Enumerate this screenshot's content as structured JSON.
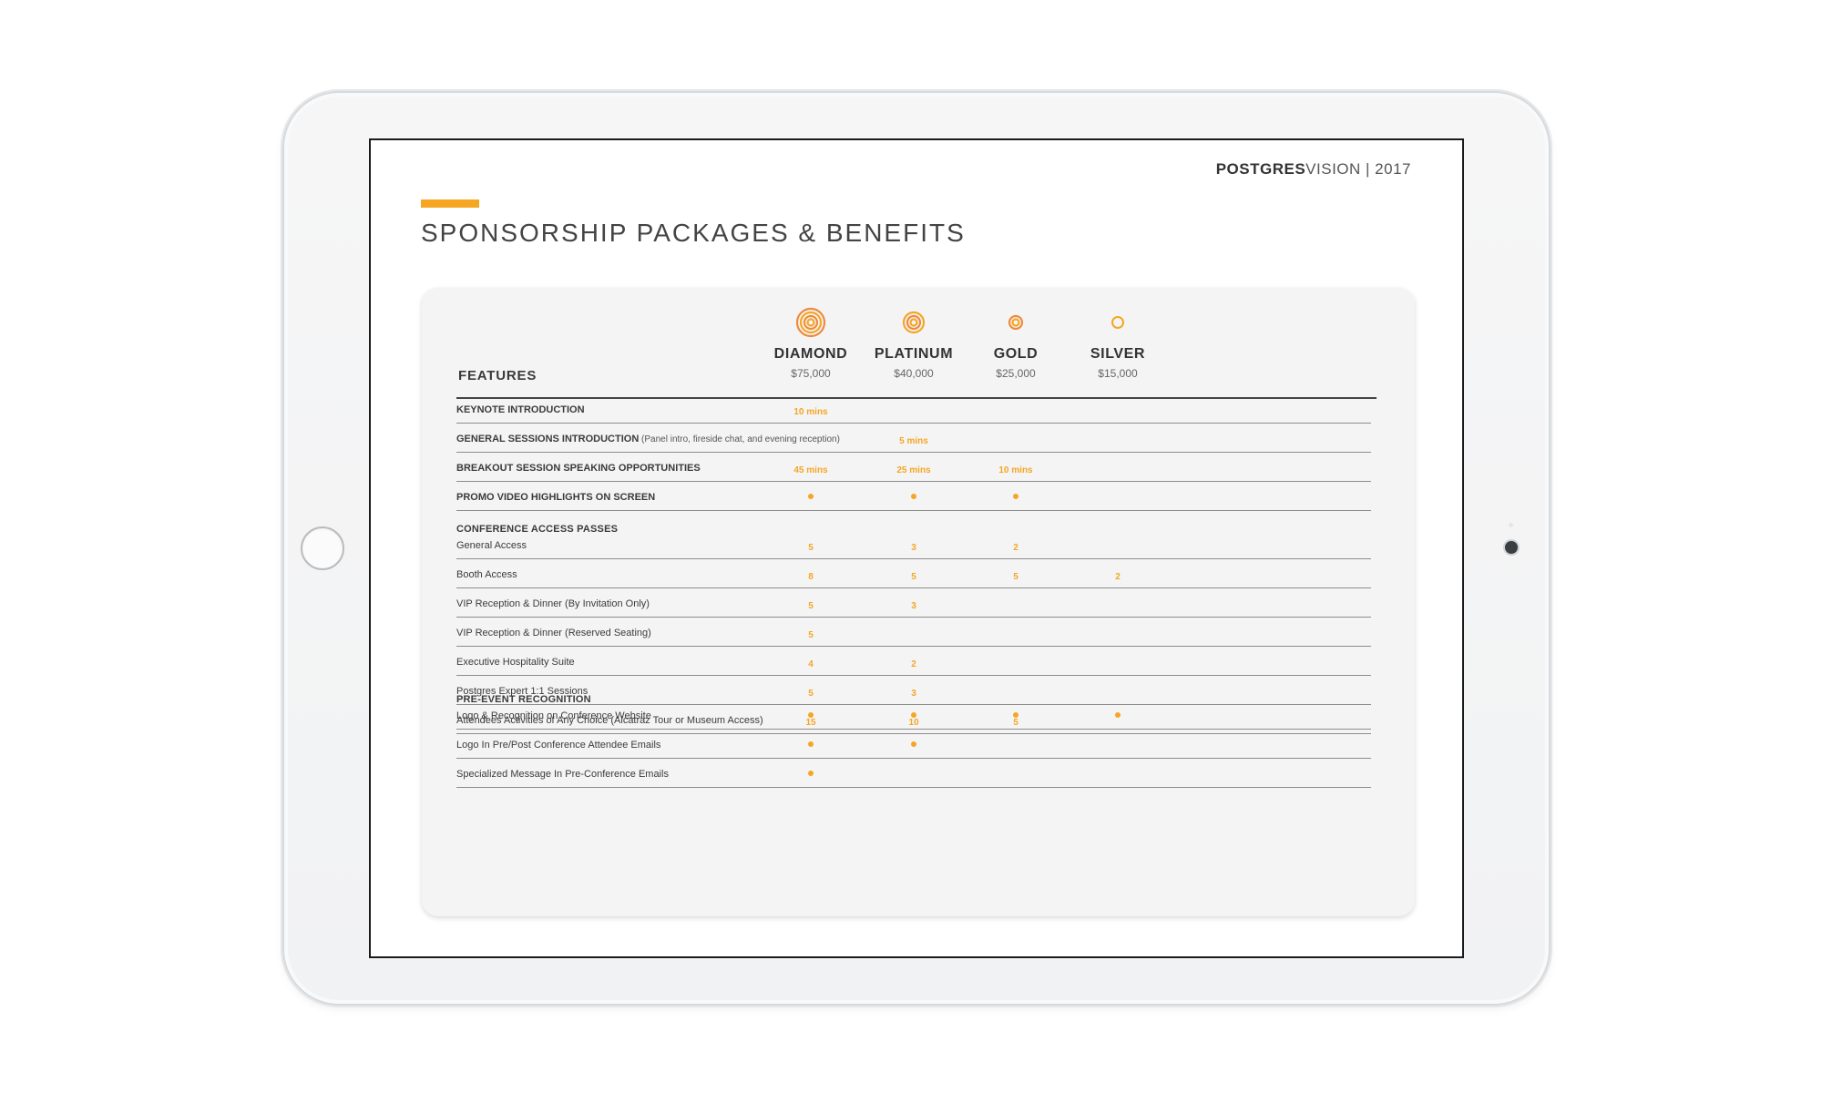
{
  "brand": {
    "bold": "POSTGRES",
    "light": "VISION",
    "year": "| 2017"
  },
  "title": "SPONSORSHIP PACKAGES & BENEFITS",
  "features_label": "FEATURES",
  "colors": {
    "accent": "#f5a623",
    "ring_outer": "#f08a3c",
    "ring_inner": "#f5a623"
  },
  "tiers": [
    {
      "name": "DIAMOND",
      "price": "$75,000",
      "icon": "diamond-rings-icon"
    },
    {
      "name": "PLATINUM",
      "price": "$40,000",
      "icon": "platinum-rings-icon"
    },
    {
      "name": "GOLD",
      "price": "$25,000",
      "icon": "gold-rings-icon"
    },
    {
      "name": "SILVER",
      "price": "$15,000",
      "icon": "silver-ring-icon"
    }
  ],
  "rows_top": [
    {
      "label": "KEYNOTE INTRODUCTION",
      "note": "",
      "values": [
        "10 mins",
        "",
        "",
        ""
      ]
    },
    {
      "label": "GENERAL SESSIONS INTRODUCTION",
      "note": "(Panel intro, fireside chat, and evening reception)",
      "values": [
        "",
        "5 mins",
        "",
        ""
      ]
    },
    {
      "label": "BREAKOUT SESSION SPEAKING OPPORTUNITIES",
      "note": "",
      "values": [
        "45 mins",
        "25 mins",
        "10 mins",
        ""
      ]
    },
    {
      "label": "PROMO VIDEO HIGHLIGHTS ON SCREEN",
      "note": "",
      "values": [
        "dot",
        "dot",
        "dot",
        ""
      ]
    }
  ],
  "sections": [
    {
      "heading": "CONFERENCE ACCESS PASSES",
      "rows": [
        {
          "label": "General Access",
          "values": [
            "5",
            "3",
            "2",
            ""
          ]
        },
        {
          "label": "Booth Access",
          "values": [
            "8",
            "5",
            "5",
            "2"
          ]
        },
        {
          "label": "VIP Reception & Dinner (By Invitation Only)",
          "values": [
            "5",
            "3",
            "",
            ""
          ]
        },
        {
          "label": "VIP Reception & Dinner (Reserved Seating)",
          "values": [
            "5",
            "",
            "",
            ""
          ]
        },
        {
          "label": "Executive Hospitality Suite",
          "values": [
            "4",
            "2",
            "",
            ""
          ]
        },
        {
          "label": "Postgres Expert 1:1 Sessions",
          "values": [
            "5",
            "3",
            "",
            ""
          ]
        },
        {
          "label": "Attendees Activities of Any Choice (Alcatraz Tour or Museum Access)",
          "values": [
            "15",
            "10",
            "5",
            ""
          ]
        }
      ]
    },
    {
      "heading": "PRE-EVENT RECOGNITION",
      "rows": [
        {
          "label": "Logo & Recognition on Conference Website",
          "values": [
            "dot",
            "dot",
            "dot",
            "dot"
          ]
        },
        {
          "label": "Logo In Pre/Post Conference Attendee Emails",
          "values": [
            "dot",
            "dot",
            "",
            ""
          ]
        },
        {
          "label": "Specialized Message In Pre-Conference Emails",
          "values": [
            "dot",
            "",
            "",
            ""
          ]
        }
      ]
    }
  ]
}
